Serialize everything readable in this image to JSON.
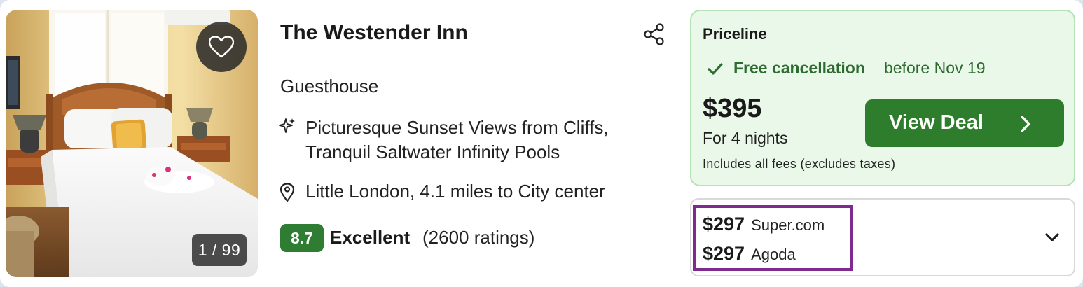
{
  "listing": {
    "photo": {
      "counter": "1 / 99",
      "alt": "hotel-room-photo"
    },
    "name": "The Westender Inn",
    "type": "Guesthouse",
    "feature": "Picturesque Sunset Views from Cliffs, Tranquil Saltwater Infinity Pools",
    "location": "Little London, 4.1 miles to City center",
    "rating": {
      "score": "8.7",
      "label": "Excellent",
      "count": "(2600 ratings)"
    }
  },
  "deal": {
    "provider": "Priceline",
    "cancellation": "Free cancellation",
    "cancellation_date": "before Nov 19",
    "price": "$395",
    "nights": "For 4 nights",
    "fees_note": "Includes all fees (excludes taxes)",
    "cta_label": "View Deal"
  },
  "other_offers": [
    {
      "price": "$297",
      "site": "Super.com"
    },
    {
      "price": "$297",
      "site": "Agoda"
    }
  ],
  "colors": {
    "accent_green": "#2e7d2c",
    "deal_bg": "#e9f8e8",
    "highlight": "#7e2a8e"
  },
  "icons": [
    "heart-icon",
    "share-icon",
    "sparkle-icon",
    "map-pin-icon",
    "check-icon",
    "chevron-right-icon",
    "chevron-down-icon"
  ]
}
